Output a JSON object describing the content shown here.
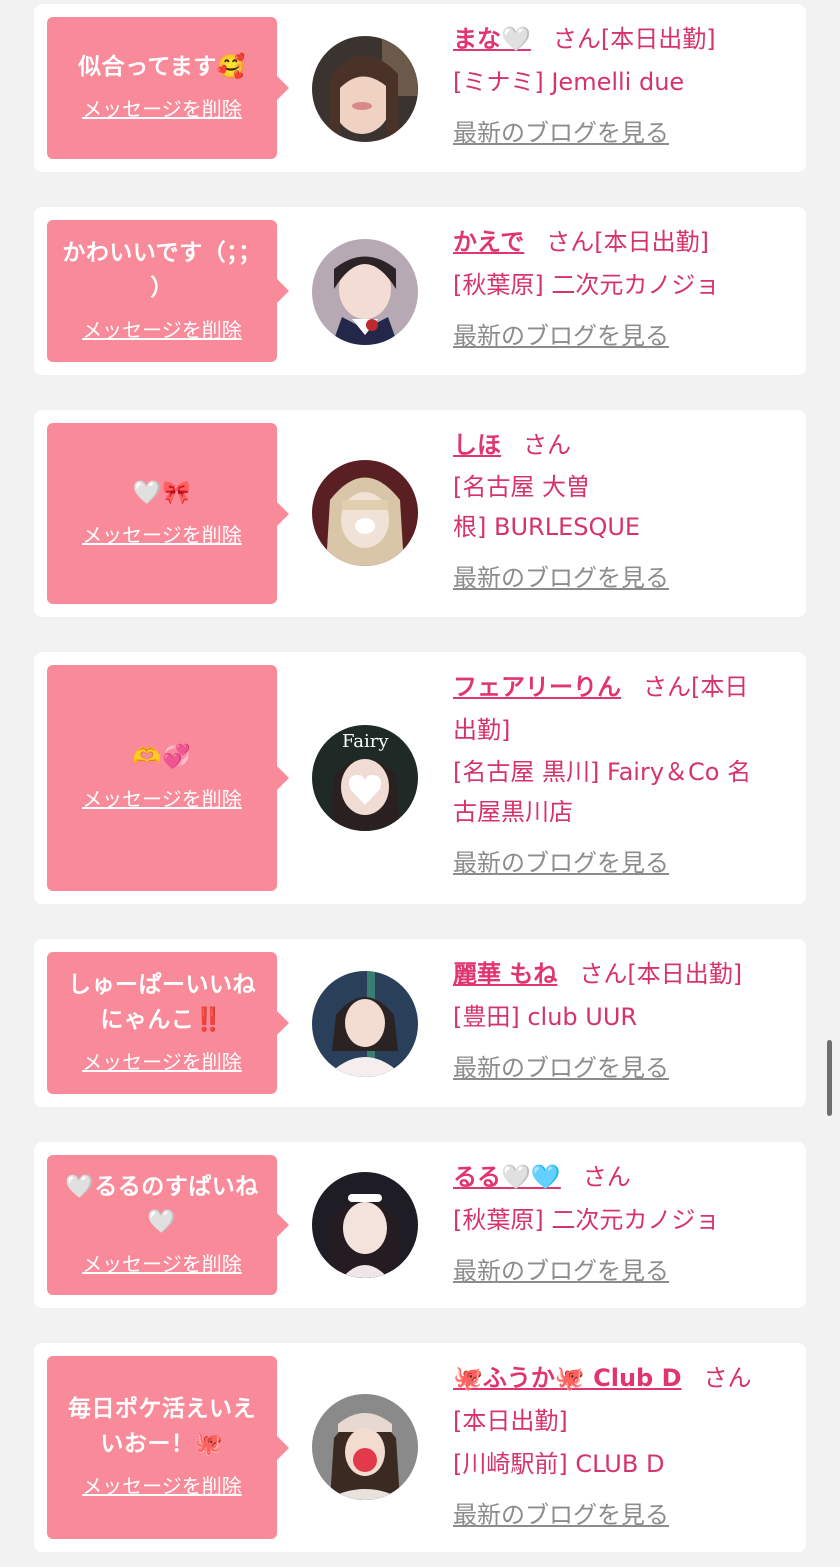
{
  "colors": {
    "accent_pink": "#f98a9a",
    "name_pink": "#e0356f",
    "text_pink": "#d6336c",
    "link_gray": "#8c8c8c",
    "background": "#f2f2f2"
  },
  "delete_label": "メッセージを削除",
  "blog_label": "最新のブログを見る",
  "honorific": "さん",
  "cards": [
    {
      "message": "似合ってます🥰",
      "name": "まな🤍",
      "status": "[本日出勤]",
      "shop": "[ミナミ] Jemelli due"
    },
    {
      "message": "かわいいです（；；\n）",
      "name": "かえで",
      "status": "[本日出勤]",
      "shop": "[秋葉原] 二次元カノジョ"
    },
    {
      "message": "🤍🎀",
      "name": "しほ",
      "status": "",
      "shop": "[名古屋 大曽\n根] BURLESQUE"
    },
    {
      "message": "🫶💞",
      "name": "フェアリーりん",
      "status": "[本日\n出勤]",
      "shop": "[名古屋 黒川] Fairy＆Co 名\n古屋黒川店"
    },
    {
      "message": "しゅーぱーいいね\nにゃんこ‼️",
      "name": "麗華 もね",
      "status": "[本日出勤]",
      "shop": "[豊田] club UUR"
    },
    {
      "message": "🤍るるのすぱいね\n🤍",
      "name": "るる🤍🩵",
      "status": "",
      "shop": "[秋葉原] 二次元カノジョ"
    },
    {
      "message": "毎日ポケ活えいえ\nいおー！🐙",
      "name": "🐙ふうか🐙 Club D",
      "status": "\n[本日出勤]",
      "shop": "[川崎駅前] CLUB D"
    }
  ]
}
